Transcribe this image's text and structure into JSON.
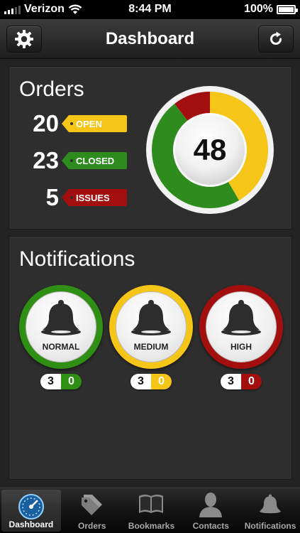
{
  "status_bar": {
    "carrier": "Verizon",
    "time": "8:44 PM",
    "battery": "100%"
  },
  "nav": {
    "title": "Dashboard",
    "settings_icon": "gear-icon",
    "refresh_icon": "refresh-icon"
  },
  "orders": {
    "title": "Orders",
    "rows": [
      {
        "count": "20",
        "label": "OPEN",
        "color": "#f5c518"
      },
      {
        "count": "23",
        "label": "CLOSED",
        "color": "#2e8b1e"
      },
      {
        "count": "5",
        "label": "ISSUES",
        "color": "#a30f0f"
      }
    ],
    "total": "48",
    "gauge_colors": {
      "open": "#f5c518",
      "closed": "#2e8b1e",
      "issues": "#a30f0f"
    }
  },
  "notifications": {
    "title": "Notifications",
    "items": [
      {
        "label": "NORMAL",
        "total": "3",
        "count": "0",
        "color": "#2f8f14"
      },
      {
        "label": "MEDIUM",
        "total": "3",
        "count": "0",
        "color": "#f5c518"
      },
      {
        "label": "HIGH",
        "total": "3",
        "count": "0",
        "color": "#a30f0f"
      }
    ]
  },
  "tabs": [
    {
      "label": "Dashboard",
      "icon": "speedometer-icon",
      "active": true
    },
    {
      "label": "Orders",
      "icon": "tags-icon",
      "active": false
    },
    {
      "label": "Bookmarks",
      "icon": "book-icon",
      "active": false
    },
    {
      "label": "Contacts",
      "icon": "person-icon",
      "active": false
    },
    {
      "label": "Notifications",
      "icon": "bell-icon",
      "active": false
    }
  ]
}
